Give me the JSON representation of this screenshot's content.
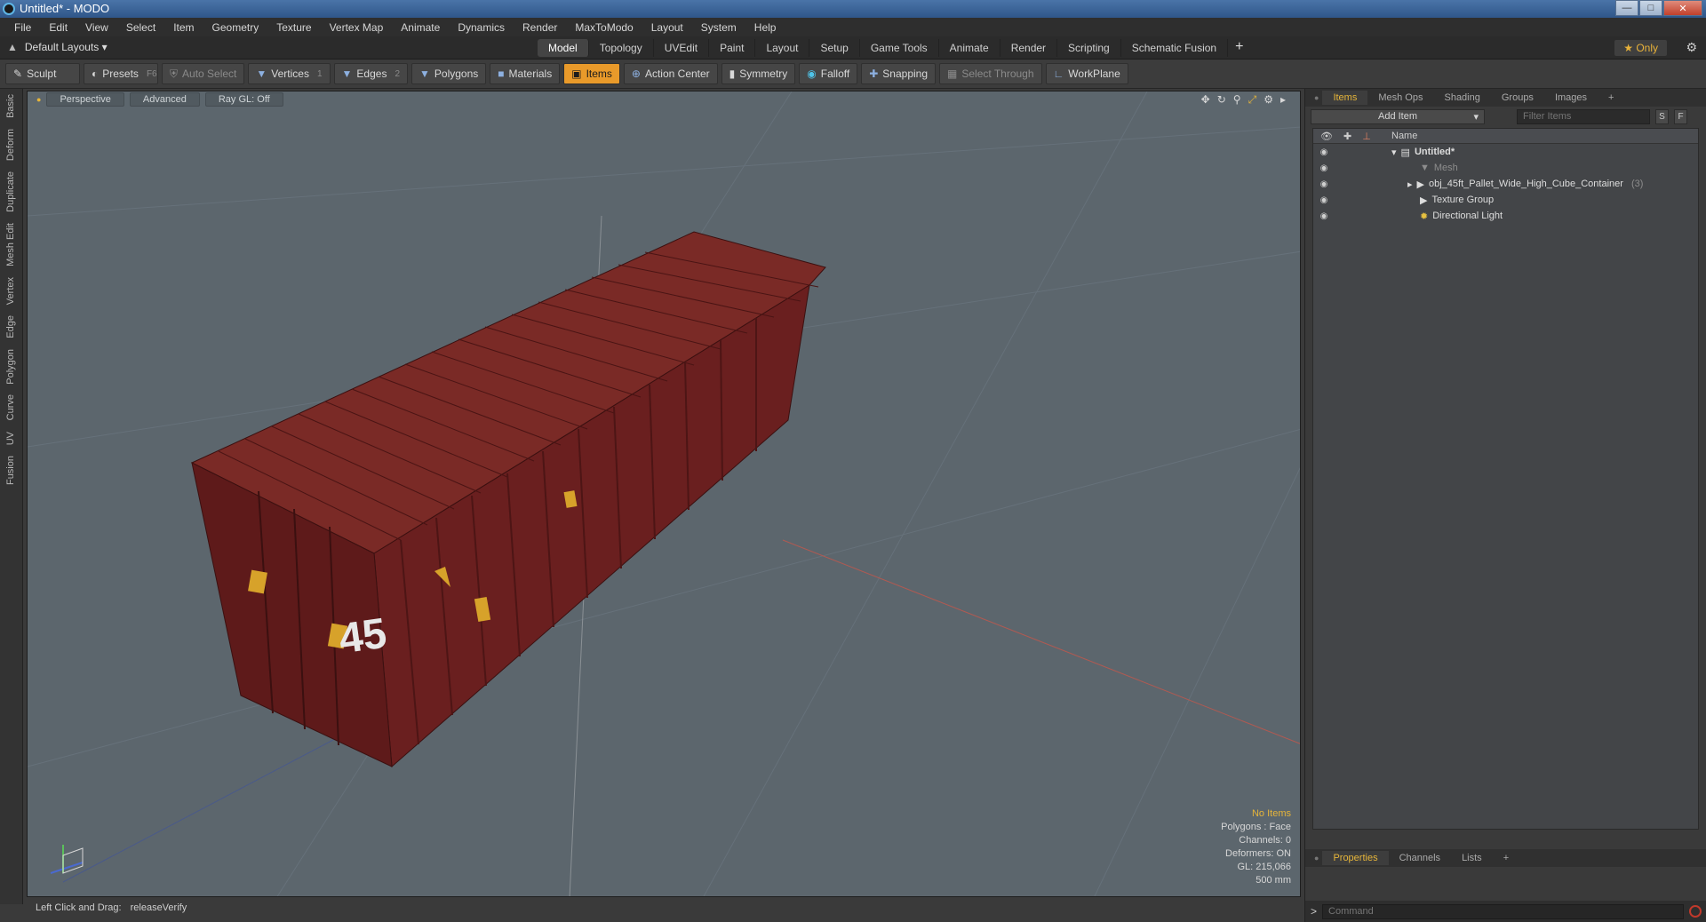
{
  "window": {
    "title": "Untitled* - MODO"
  },
  "menu": [
    "File",
    "Edit",
    "View",
    "Select",
    "Item",
    "Geometry",
    "Texture",
    "Vertex Map",
    "Animate",
    "Dynamics",
    "Render",
    "MaxToModo",
    "Layout",
    "System",
    "Help"
  ],
  "layouts": {
    "label": "Default Layouts"
  },
  "tabs": [
    {
      "label": "Model",
      "active": true
    },
    {
      "label": "Topology"
    },
    {
      "label": "UVEdit"
    },
    {
      "label": "Paint"
    },
    {
      "label": "Layout"
    },
    {
      "label": "Setup"
    },
    {
      "label": "Game Tools"
    },
    {
      "label": "Animate"
    },
    {
      "label": "Render"
    },
    {
      "label": "Scripting"
    },
    {
      "label": "Schematic Fusion"
    }
  ],
  "only_label": "Only",
  "toolbar": {
    "sculpt": "Sculpt",
    "presets": "Presets",
    "presets_key": "F6",
    "auto_select": "Auto Select",
    "vertices": "Vertices",
    "vertices_key": "1",
    "edges": "Edges",
    "edges_key": "2",
    "polygons": "Polygons",
    "materials": "Materials",
    "items": "Items",
    "action_center": "Action Center",
    "symmetry": "Symmetry",
    "falloff": "Falloff",
    "snapping": "Snapping",
    "select_through": "Select Through",
    "workplane": "WorkPlane"
  },
  "left_tabs": [
    "Basic",
    "Deform",
    "Duplicate",
    "Mesh Edit",
    "Vertex",
    "Edge",
    "Polygon",
    "Curve",
    "UV",
    "Fusion"
  ],
  "viewport": {
    "view": "Perspective",
    "advanced": "Advanced",
    "raygl": "Ray GL: Off",
    "container_number": "45",
    "stats": {
      "no_items": "No Items",
      "polygons": "Polygons : Face",
      "channels": "Channels: 0",
      "deformers": "Deformers: ON",
      "gl": "GL: 215,066",
      "scale": "500 mm"
    }
  },
  "status": {
    "hint": "Left Click and Drag:",
    "action": "releaseVerify"
  },
  "right": {
    "tabs": [
      "Items",
      "Mesh Ops",
      "Shading",
      "Groups",
      "Images"
    ],
    "add_item": "Add Item",
    "filter_placeholder": "Filter Items",
    "s_btn": "S",
    "f_btn": "F",
    "name_col": "Name",
    "tree": [
      {
        "label": "Untitled*",
        "bold": true
      },
      {
        "label": "Mesh",
        "dim": true
      },
      {
        "label": "obj_45ft_Pallet_Wide_High_Cube_Container",
        "count": "(3)"
      },
      {
        "label": "Texture Group"
      },
      {
        "label": "Directional Light"
      }
    ],
    "bottom_tabs": [
      "Properties",
      "Channels",
      "Lists"
    ],
    "command_placeholder": "Command",
    "command_prompt": ">"
  },
  "colors": {
    "accent": "#e99a2a",
    "viewport_bg": "#5c666d",
    "container": "#6e1f1f"
  }
}
